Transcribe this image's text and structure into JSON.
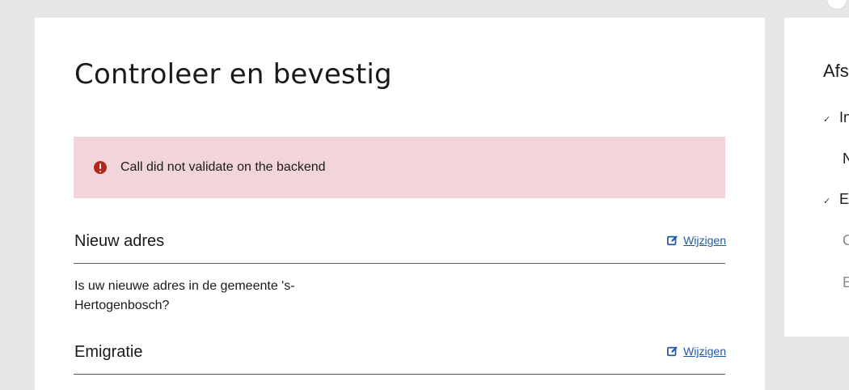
{
  "page": {
    "title": "Controleer en bevestig"
  },
  "error": {
    "message": "Call did not validate on the backend",
    "icon": "exclamation-circle-icon",
    "color": "#b3261e",
    "background": "#f2d5da"
  },
  "sections": [
    {
      "heading": "Nieuw adres",
      "edit_label": "Wijzigen",
      "question": "Is uw nieuwe adres in de gemeente 's-Hertogenbosch?"
    },
    {
      "heading": "Emigratie",
      "edit_label": "Wijzigen"
    }
  ],
  "sidebar": {
    "title": "Afs",
    "items": [
      {
        "label": "In",
        "checked": true
      },
      {
        "label": "N",
        "checked": false
      },
      {
        "label": "E",
        "checked": true
      },
      {
        "label": "C",
        "checked": false
      },
      {
        "label": "E",
        "checked": false
      }
    ]
  },
  "colors": {
    "link": "#1e5aa8",
    "background": "#e6e6e6",
    "card": "#ffffff"
  }
}
